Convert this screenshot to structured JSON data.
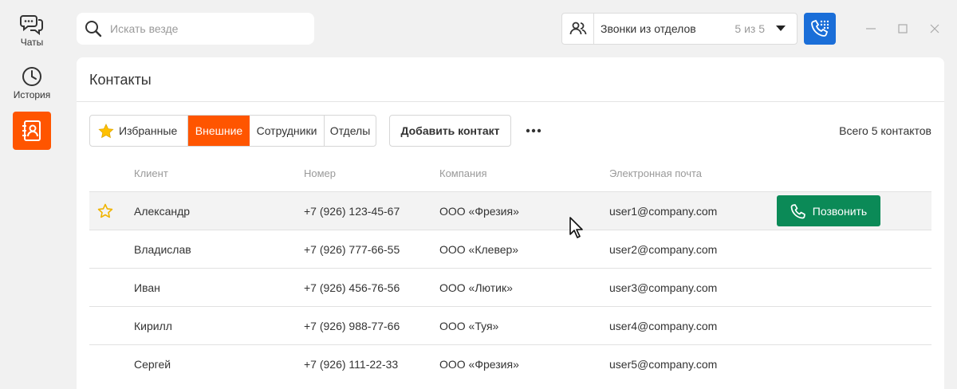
{
  "nav": {
    "chats_label": "Чаты",
    "history_label": "История",
    "active_color": "#ff5500"
  },
  "topbar": {
    "search_placeholder": "Искать везде",
    "dept_label": "Звонки из отделов",
    "dept_count": "5 из 5",
    "dial_color": "#1a6ed8"
  },
  "panel": {
    "title": "Контакты",
    "tabs": {
      "favorites": "Избранные",
      "external": "Внешние",
      "employees": "Сотрудники",
      "departments": "Отделы"
    },
    "add_contact_label": "Добавить контакт",
    "total_label": "Всего 5 контактов"
  },
  "table": {
    "headers": {
      "client": "Клиент",
      "phone": "Номер",
      "company": "Компания",
      "email": "Электронная почта"
    },
    "rows": [
      {
        "client": "Александр",
        "phone": "+7 (926) 123-45-67",
        "company": "ООО «Фрезия»",
        "email": "user1@company.com"
      },
      {
        "client": "Владислав",
        "phone": "+7 (926) 777-66-55",
        "company": "ООО «Клевер»",
        "email": "user2@company.com"
      },
      {
        "client": "Иван",
        "phone": "+7 (926) 456-76-56",
        "company": "ООО «Лютик»",
        "email": "user3@company.com"
      },
      {
        "client": "Кирилл",
        "phone": "+7 (926) 988-77-66",
        "company": "ООО «Туя»",
        "email": "user4@company.com"
      },
      {
        "client": "Сергей",
        "phone": "+7 (926) 111-22-33",
        "company": "ООО «Фрезия»",
        "email": "user5@company.com"
      }
    ],
    "call_label": "Позвонить",
    "call_color": "#0b8a57"
  }
}
